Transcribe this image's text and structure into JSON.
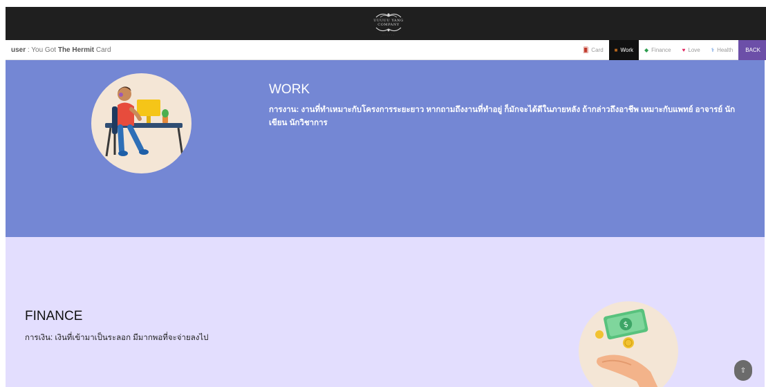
{
  "header": {
    "logo_text_line1": "UUUUU YANG",
    "logo_text_line2": "COMPANY",
    "logo_text_line3": "· · · · · ·"
  },
  "navbar": {
    "user_label": "user",
    "user_sep": " : You Got ",
    "card_name": "The Hermit",
    "card_suffix": " Card",
    "items": [
      {
        "label": "Card",
        "icon": "card-icon",
        "active": false
      },
      {
        "label": "Work",
        "icon": "briefcase-icon",
        "active": true
      },
      {
        "label": "Finance",
        "icon": "money-icon",
        "active": false
      },
      {
        "label": "Love",
        "icon": "heart-icon",
        "active": false
      },
      {
        "label": "Health",
        "icon": "stethoscope-icon",
        "active": false
      }
    ],
    "back_label": "BACK"
  },
  "work": {
    "title": "WORK",
    "text": "การงาน: งานที่ทำเหมาะกับโครงการระยะยาว หากถามถึงงานที่ทำอยู่ ก็มักจะได้ดีในภายหลัง ถ้ากล่าวถึงอาชีพ เหมาะกับแพทย์ อาจารย์ นักเขียน นักวิชาการ",
    "image": "person-at-computer-illustration"
  },
  "finance": {
    "title": "FINANCE",
    "text": "การเงิน: เงินที่เข้ามาเป็นระลอก มีมากพอที่จะจ่ายลงไป",
    "image": "hand-with-money-illustration"
  },
  "scroll_top": {
    "label": "⇧"
  },
  "colors": {
    "topbar": "#1f1f1f",
    "work_bg": "#7487d4",
    "finance_bg": "#e3defe",
    "back_button": "#6c4fa8",
    "circle_bg": "#f4e6d6"
  }
}
